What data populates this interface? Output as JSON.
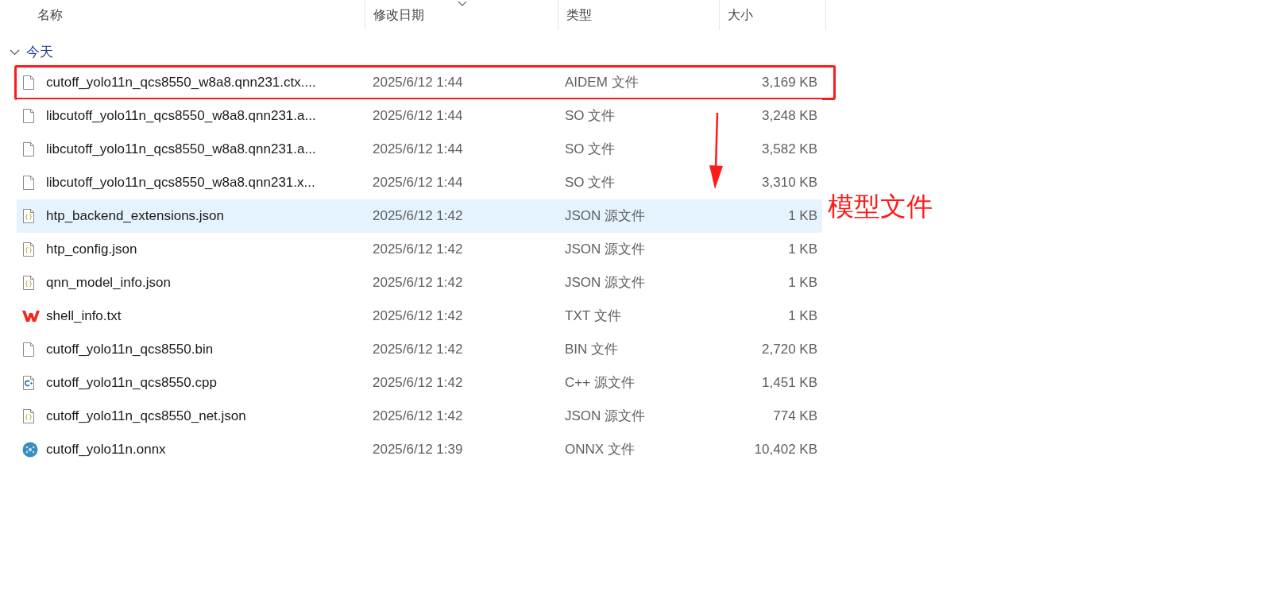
{
  "columns": [
    {
      "label": "名称",
      "sorted": false
    },
    {
      "label": "修改日期",
      "sorted": true
    },
    {
      "label": "类型",
      "sorted": false
    },
    {
      "label": "大小",
      "sorted": false
    }
  ],
  "group": {
    "label": "今天",
    "expanded": true
  },
  "rows": [
    {
      "kind": "file",
      "name": "cutoff_yolo11n_qcs8550_w8a8.qnn231.ctx....",
      "date": "2025/6/12 1:44",
      "type": "AIDEM 文件",
      "size": "3,169 KB",
      "selected": false,
      "boxed": true
    },
    {
      "kind": "file",
      "name": "libcutoff_yolo11n_qcs8550_w8a8.qnn231.a...",
      "date": "2025/6/12 1:44",
      "type": "SO 文件",
      "size": "3,248 KB",
      "selected": false,
      "boxed": false
    },
    {
      "kind": "file",
      "name": "libcutoff_yolo11n_qcs8550_w8a8.qnn231.a...",
      "date": "2025/6/12 1:44",
      "type": "SO 文件",
      "size": "3,582 KB",
      "selected": false,
      "boxed": false
    },
    {
      "kind": "file",
      "name": "libcutoff_yolo11n_qcs8550_w8a8.qnn231.x...",
      "date": "2025/6/12 1:44",
      "type": "SO 文件",
      "size": "3,310 KB",
      "selected": false,
      "boxed": false
    },
    {
      "kind": "json",
      "name": "htp_backend_extensions.json",
      "date": "2025/6/12 1:42",
      "type": "JSON 源文件",
      "size": "1 KB",
      "selected": true,
      "boxed": false
    },
    {
      "kind": "json",
      "name": "htp_config.json",
      "date": "2025/6/12 1:42",
      "type": "JSON 源文件",
      "size": "1 KB",
      "selected": false,
      "boxed": false
    },
    {
      "kind": "json",
      "name": "qnn_model_info.json",
      "date": "2025/6/12 1:42",
      "type": "JSON 源文件",
      "size": "1 KB",
      "selected": false,
      "boxed": false
    },
    {
      "kind": "wps",
      "name": "shell_info.txt",
      "date": "2025/6/12 1:42",
      "type": "TXT 文件",
      "size": "1 KB",
      "selected": false,
      "boxed": false
    },
    {
      "kind": "file",
      "name": "cutoff_yolo11n_qcs8550.bin",
      "date": "2025/6/12 1:42",
      "type": "BIN 文件",
      "size": "2,720 KB",
      "selected": false,
      "boxed": false
    },
    {
      "kind": "cpp",
      "name": "cutoff_yolo11n_qcs8550.cpp",
      "date": "2025/6/12 1:42",
      "type": "C++ 源文件",
      "size": "1,451 KB",
      "selected": false,
      "boxed": false
    },
    {
      "kind": "json",
      "name": "cutoff_yolo11n_qcs8550_net.json",
      "date": "2025/6/12 1:42",
      "type": "JSON 源文件",
      "size": "774 KB",
      "selected": false,
      "boxed": false
    },
    {
      "kind": "onnx",
      "name": "cutoff_yolo11n.onnx",
      "date": "2025/6/12 1:39",
      "type": "ONNX 文件",
      "size": "10,402 KB",
      "selected": false,
      "boxed": false
    }
  ],
  "annotation": {
    "label": "模型文件"
  }
}
